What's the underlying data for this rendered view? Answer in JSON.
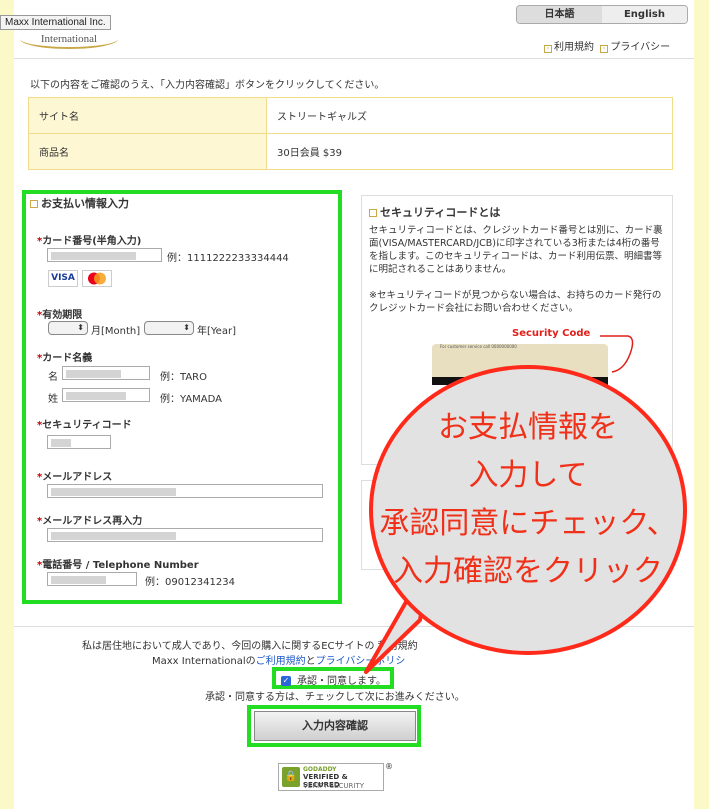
{
  "header": {
    "logo_tooltip": "Maxx International Inc.",
    "logo_text": "International",
    "lang_ja": "日本語",
    "lang_en": "English",
    "terms_link": "利用規約",
    "privacy_link": "プライバシー"
  },
  "intro": "以下の内容をご確認のうえ、「入力内容確認」ボタンをクリックしてください。",
  "summary": {
    "site_label": "サイト名",
    "site_value": "ストリートギャルズ",
    "product_label": "商品名",
    "product_value": "30日会員 $39"
  },
  "payment": {
    "title": "お支払い情報入力",
    "card_number_label": "カード番号(半角入力)",
    "card_number_example": "例：1111222233334444",
    "card_brands": [
      "VISA",
      "MasterCard"
    ],
    "expiry_label": "有効期限",
    "month_suffix": "月[Month]",
    "year_suffix": "年[Year]",
    "name_label": "カード名義",
    "first_name_prefix": "名",
    "first_name_example": "例：TARO",
    "last_name_prefix": "姓",
    "last_name_example": "例：YAMADA",
    "security_label": "セキュリティコード",
    "email_label": "メールアドレス",
    "email_confirm_label": "メールアドレス再入力",
    "phone_label": "電話番号 / Telephone Number",
    "phone_example": "例：09012341234",
    "required_mark": "*"
  },
  "security_info": {
    "title": "セキュリティコードとは",
    "body": "セキュリティコードとは、クレジットカード番号とは別に、カード裏面(VISA/MASTERCARD/JCB)に印字されている3桁または4桁の番号を指します。このセキュリティコードは、カード利用伝票、明細書等に明記されることはありません。",
    "note": "※セキュリティコードが見つからない場合は、お持ちのカード発行のクレジットカード会社にお問い合わせください。",
    "code_callout": "Security Code",
    "card_small_text": "For customer service call 0000000000"
  },
  "annotation": {
    "line1": "お支払情報を",
    "line2": "入力して",
    "line3": "承認同意にチェック、",
    "line4": "入力確認をクリック"
  },
  "footer": {
    "consent_line1": "私は居住地において成人であり、今回の購入に関するECサイトの 利用規約",
    "consent_line2_a": "Maxx Internationalの",
    "consent_link1": "ご利用規約",
    "consent_line2_b": "と",
    "consent_link2": "プライバシーポリシ",
    "agree_label": "承認・同意します。",
    "agree_note": "承認・同意する方は、チェックして次にお進みください。",
    "confirm_button": "入力内容確認",
    "seal_brand": "GODADDY",
    "seal_line1": "VERIFIED & SECURED",
    "seal_line2": "VERIFY SECURITY"
  }
}
